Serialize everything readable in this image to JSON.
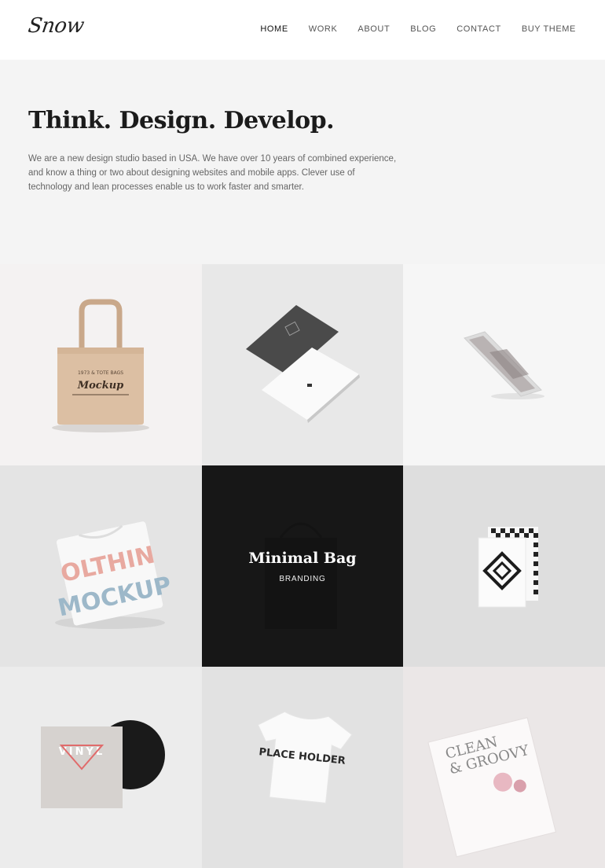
{
  "header": {
    "logo": "Snow",
    "nav": [
      {
        "label": "HOME",
        "active": true
      },
      {
        "label": "WORK",
        "active": false
      },
      {
        "label": "ABOUT",
        "active": false
      },
      {
        "label": "BLOG",
        "active": false
      },
      {
        "label": "CONTACT",
        "active": false
      },
      {
        "label": "BUY THEME",
        "active": false
      }
    ]
  },
  "hero": {
    "title": "Think. Design. Develop.",
    "body": "We are a new design studio based in USA. We have over 10 years of combined experience, and know a thing or two about designing websites and mobile apps. Clever use of technology and lean processes enable us to work faster and smarter."
  },
  "portfolio": {
    "hovered": {
      "title": "Minimal Bag",
      "category": "BRANDING"
    },
    "tiles": [
      {
        "id": "tote-bag",
        "mockup_text": [
          "1973 & TOTE BAGS",
          "Mockup"
        ]
      },
      {
        "id": "business-cards",
        "mockup_text": []
      },
      {
        "id": "phone",
        "mockup_text": []
      },
      {
        "id": "tshirt-folded",
        "mockup_text": [
          "OLTHIN",
          "MOCKUP"
        ]
      },
      {
        "id": "minimal-bag",
        "mockup_text": []
      },
      {
        "id": "stationery",
        "mockup_text": []
      },
      {
        "id": "vinyl",
        "mockup_text": [
          "VINYL"
        ]
      },
      {
        "id": "tshirt-placeholder",
        "mockup_text": [
          "PLACE HOLDER"
        ]
      },
      {
        "id": "magazine",
        "mockup_text": [
          "CLEAN",
          "& GROOVY"
        ]
      }
    ]
  },
  "colors": {
    "header_bg": "#ffffff",
    "page_bg": "#f4f4f4",
    "overlay_bg": "#232323"
  }
}
